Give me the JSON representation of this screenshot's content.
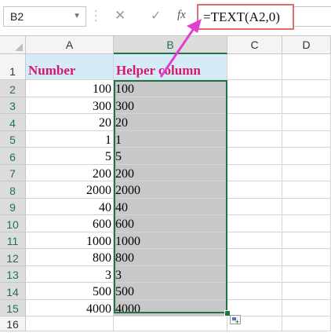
{
  "name_box": {
    "value": "B2"
  },
  "formula_bar": {
    "cancel_symbol": "✕",
    "enter_symbol": "✓",
    "fx_label": "fx",
    "formula": "=TEXT(A2,0)"
  },
  "columns": [
    "A",
    "B",
    "C",
    "D"
  ],
  "rows": [
    "1",
    "2",
    "3",
    "4",
    "5",
    "6",
    "7",
    "8",
    "9",
    "10",
    "11",
    "12",
    "13",
    "14",
    "15",
    "16"
  ],
  "header_row": {
    "a": "Number",
    "b": "Helper column"
  },
  "data": [
    {
      "a": "100",
      "b": "100"
    },
    {
      "a": "300",
      "b": "300"
    },
    {
      "a": "20",
      "b": "20"
    },
    {
      "a": "1",
      "b": "1"
    },
    {
      "a": "5",
      "b": "5"
    },
    {
      "a": "200",
      "b": "200"
    },
    {
      "a": "2000",
      "b": "2000"
    },
    {
      "a": "40",
      "b": "40"
    },
    {
      "a": "600",
      "b": "600"
    },
    {
      "a": "1000",
      "b": "1000"
    },
    {
      "a": "800",
      "b": "800"
    },
    {
      "a": "3",
      "b": "3"
    },
    {
      "a": "500",
      "b": "500"
    },
    {
      "a": "4000",
      "b": "4000"
    }
  ],
  "colors": {
    "header_fill": "#d5ebf7",
    "header_text": "#d6176f",
    "selection_fill": "#c8c8c8",
    "selection_border": "#217346",
    "formula_highlight": "#e56b6f",
    "arrow": "#e040d0"
  }
}
